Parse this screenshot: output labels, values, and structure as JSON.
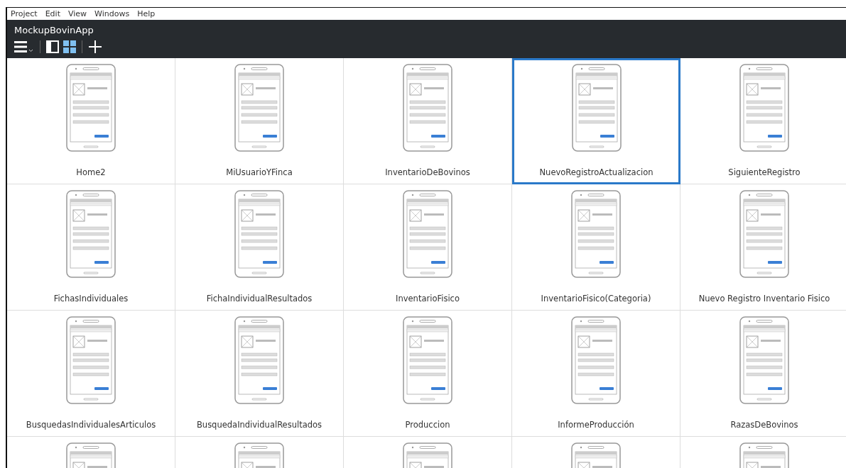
{
  "menu": [
    "Project",
    "Edit",
    "View",
    "Windows",
    "Help"
  ],
  "window": {
    "title": "MockupBovinApp"
  },
  "toolbar": {
    "views": [
      {
        "kind": "single",
        "selected": false
      },
      {
        "kind": "grid",
        "selected": true
      }
    ]
  },
  "mockups": [
    {
      "name": "Home2",
      "selected": false
    },
    {
      "name": "MiUsuarioYFinca",
      "selected": false
    },
    {
      "name": "InventarioDeBovinos",
      "selected": false
    },
    {
      "name": "NuevoRegistroActualizacion",
      "selected": true
    },
    {
      "name": "SiguienteRegistro",
      "selected": false
    },
    {
      "name": "FichasIndividuales",
      "selected": false
    },
    {
      "name": "FichaIndividualResultados",
      "selected": false
    },
    {
      "name": "InventarioFisico",
      "selected": false
    },
    {
      "name": "InventarioFisico(Categoria)",
      "selected": false
    },
    {
      "name": "Nuevo Registro Inventario Fisico",
      "selected": false
    },
    {
      "name": "BusquedasIndividualesArticulos",
      "selected": false
    },
    {
      "name": "BusquedaIndividualResultados",
      "selected": false
    },
    {
      "name": "Produccion",
      "selected": false
    },
    {
      "name": "InformeProducción",
      "selected": false
    },
    {
      "name": "RazasDeBovinos",
      "selected": false
    },
    {
      "selected": false
    },
    {
      "selected": false
    },
    {
      "selected": false
    },
    {
      "selected": false
    },
    {
      "selected": false
    }
  ]
}
